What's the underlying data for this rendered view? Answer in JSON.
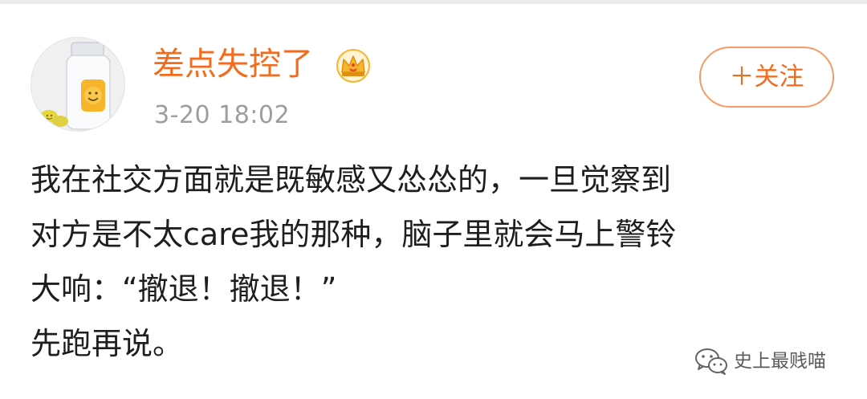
{
  "post": {
    "username": "差点失控了",
    "timestamp": "3-20 18:02",
    "follow_label": "＋关注",
    "lines": [
      "我在社交方面就是既敏感又怂怂的，一旦觉察到",
      "对方是不太care我的那种，脑子里就会马上警铃",
      "大响：“撤退！撤退！”",
      "先跑再说。"
    ]
  },
  "watermark": {
    "text": "史上最贱喵"
  },
  "colors": {
    "username": "#f36b1c",
    "follow_border": "#f79a63",
    "timestamp": "#9d9d9d",
    "body_text": "#1e1e1e",
    "crown": "#f6b52a"
  },
  "icons": {
    "avatar": "pill-bottle-smiley-avatar",
    "badge": "crown-icon",
    "watermark": "wechat-icon"
  }
}
